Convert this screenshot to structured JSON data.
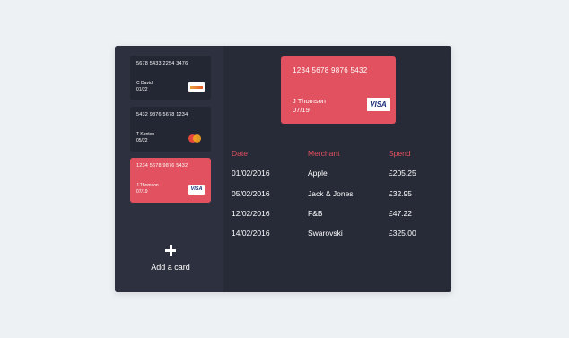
{
  "colors": {
    "accent": "#e1515f",
    "panel": "#272a37",
    "sidebar": "#2d303e",
    "card": "#232633"
  },
  "cards": [
    {
      "number": "5678 5433 2254 3476",
      "name": "C David",
      "expiry": "01/22",
      "brand": "discover-icon"
    },
    {
      "number": "5432 9876 5678 1234",
      "name": "T Konten",
      "expiry": "05/22",
      "brand": "mastercard-icon"
    },
    {
      "number": "1234 5678 9876 5432",
      "name": "J Thomson",
      "expiry": "07/19",
      "brand": "VISA"
    }
  ],
  "add_card": {
    "label": "Add a card",
    "icon": "plus-icon"
  },
  "selected_card": {
    "number": "1234 5678 9876 5432",
    "name": "J Thomson",
    "expiry": "07/19",
    "brand": "VISA"
  },
  "transactions": {
    "headers": {
      "date": "Date",
      "merchant": "Merchant",
      "spend": "Spend"
    },
    "rows": [
      {
        "date": "01/02/2016",
        "merchant": "Apple",
        "spend": "£205.25"
      },
      {
        "date": "05/02/2016",
        "merchant": "Jack & Jones",
        "spend": "£32.95"
      },
      {
        "date": "12/02/2016",
        "merchant": "F&B",
        "spend": "£47.22"
      },
      {
        "date": "14/02/2016",
        "merchant": "Swarovski",
        "spend": "£325.00"
      }
    ]
  }
}
